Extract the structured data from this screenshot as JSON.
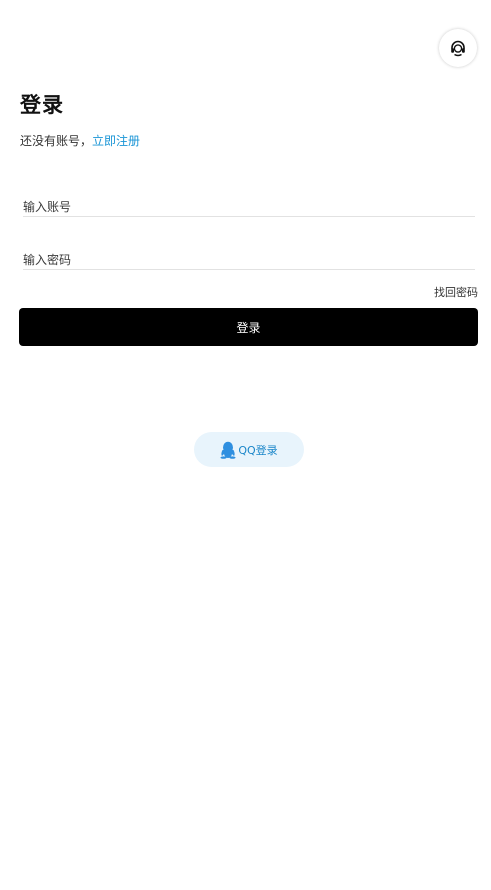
{
  "header": {
    "support_icon": "headset-icon"
  },
  "login": {
    "title": "登录",
    "no_account_text": "还没有账号，",
    "register_link": "立即注册",
    "account_placeholder": "输入账号",
    "password_placeholder": "输入密码",
    "forgot_password": "找回密码",
    "submit_label": "登录"
  },
  "third_party": {
    "qq_label": "QQ登录",
    "qq_icon": "qq-penguin-icon"
  },
  "colors": {
    "accent": "#1a95d6",
    "primary_button": "#000000",
    "qq_button_bg": "#e8f4fc"
  }
}
